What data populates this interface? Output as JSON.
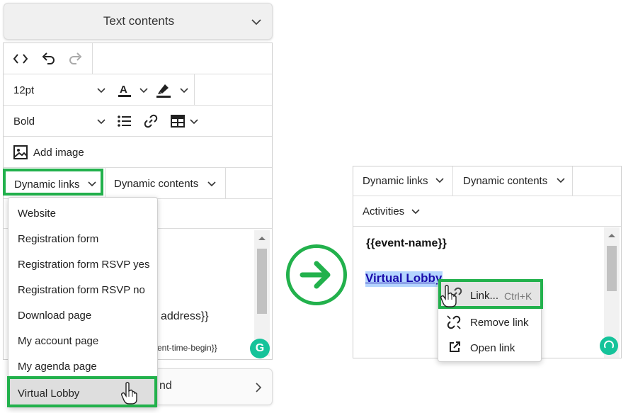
{
  "left": {
    "header": {
      "title": "Text contents"
    },
    "toolbar": {
      "font_size": "12pt",
      "font_weight": "Bold",
      "add_image": "Add image",
      "dynamic_links": "Dynamic links",
      "dynamic_contents": "Dynamic contents"
    },
    "content": {
      "line_address": "address}}",
      "line_time": "ent-time-begin}}"
    },
    "dropdown": {
      "items": [
        "Website",
        "Registration form",
        "Registration form RSVP yes",
        "Registration form RSVP no",
        "Download page",
        "My account page",
        "My agenda page",
        "Virtual Lobby"
      ],
      "selected": "Virtual Lobby"
    },
    "bottom_card": {
      "label_fragment": "nd"
    }
  },
  "right": {
    "toolbar": {
      "dynamic_links": "Dynamic links",
      "dynamic_contents": "Dynamic contents",
      "activities": "Activities"
    },
    "content": {
      "event_name": "{{event-name}}",
      "link_text": "Virtual Lobby"
    },
    "context_menu": {
      "link": "Link...",
      "link_shortcut": "Ctrl+K",
      "remove_link": "Remove link",
      "open_link": "Open link"
    }
  },
  "colors": {
    "highlight": "#22b14c",
    "link": "#1a0dab",
    "selection": "#b4d5fe",
    "grammarly": "#15c39a"
  }
}
